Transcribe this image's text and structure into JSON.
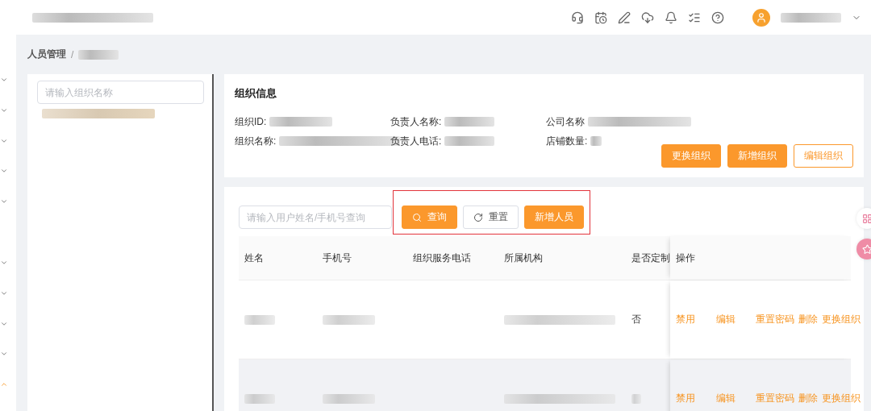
{
  "sidebar": {
    "groups": [
      {
        "expanded": false
      },
      {
        "expanded": false
      },
      {
        "expanded": false
      },
      {
        "expanded": false
      },
      {
        "expanded": false
      },
      {
        "expanded": false
      },
      {
        "expanded": false
      },
      {
        "expanded": false
      },
      {
        "expanded": false
      },
      {
        "expanded": true
      }
    ]
  },
  "breadcrumb": {
    "items": [
      "人员管理"
    ],
    "separator": "/"
  },
  "org_tree": {
    "search": {
      "placeholder": "请输入组织名称"
    }
  },
  "org_info": {
    "title": "组织信息",
    "fields": [
      {
        "label": "组织ID:"
      },
      {
        "label": "负责人名称:"
      },
      {
        "label": "公司名称"
      },
      {
        "label": "组织名称:"
      },
      {
        "label": "负责人电话:"
      },
      {
        "label": "店铺数量:"
      }
    ],
    "buttons": [
      {
        "label": "更换组织",
        "kind": "primary"
      },
      {
        "label": "新增组织",
        "kind": "primary"
      },
      {
        "label": "编辑组织",
        "kind": "outline"
      }
    ]
  },
  "staff": {
    "search": {
      "placeholder": "请输入用户姓名/手机号查询"
    },
    "buttons": [
      {
        "label": "查询",
        "kind": "primary"
      },
      {
        "label": "重置",
        "kind": "default"
      },
      {
        "label": "新增人员",
        "kind": "primary"
      }
    ],
    "table": {
      "columns": [
        "姓名",
        "手机号",
        "组织服务电话",
        "所属机构",
        "是否定制",
        "操作"
      ],
      "rows": [
        {
          "highlighted": false,
          "custom": "否",
          "actions": [
            "禁用",
            "编辑",
            "重置密码",
            "删除",
            "更换组织"
          ]
        },
        {
          "highlighted": true,
          "actions": [
            "禁用",
            "编辑",
            "重置密码",
            "删除",
            "更换组织"
          ]
        }
      ]
    }
  }
}
